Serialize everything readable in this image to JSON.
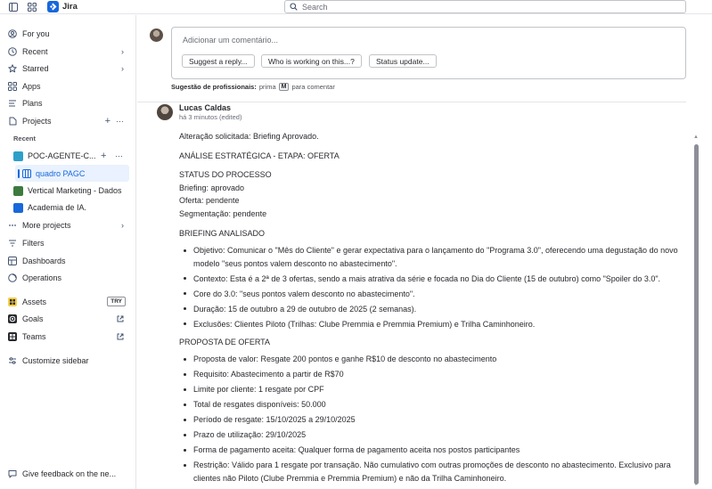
{
  "app": {
    "name": "Jira"
  },
  "search": {
    "placeholder": "Search"
  },
  "sidebar": {
    "items_top": [
      {
        "label": "For you",
        "icon": "user-circle-icon"
      },
      {
        "label": "Recent",
        "icon": "clock-icon"
      },
      {
        "label": "Starred",
        "icon": "star-icon"
      },
      {
        "label": "Apps",
        "icon": "apps-icon"
      },
      {
        "label": "Plans",
        "icon": "plans-icon"
      },
      {
        "label": "Projects",
        "icon": "projects-icon"
      }
    ],
    "recent_label": "Recent",
    "projects": [
      {
        "label": "POC-AGENTE-C...",
        "color": "#2e9fc9"
      },
      {
        "label": "quadro PAGC"
      },
      {
        "label": "Vertical Marketing - Dados",
        "color": "#3d7a3f"
      },
      {
        "label": "Academia de IA.",
        "color": "#1868db"
      }
    ],
    "more_projects": "More projects",
    "items_bottom": [
      {
        "label": "Filters",
        "icon": "filter-icon"
      },
      {
        "label": "Dashboards",
        "icon": "dashboard-icon"
      },
      {
        "label": "Operations",
        "icon": "operations-icon"
      }
    ],
    "apps": [
      {
        "label": "Assets",
        "badge": "TRY",
        "color": "#f5cd47"
      },
      {
        "label": "Goals",
        "color": "#292a2e"
      },
      {
        "label": "Teams",
        "color": "#292a2e"
      }
    ],
    "customize": "Customize sidebar",
    "feedback": "Give feedback on the ne..."
  },
  "comment_editor": {
    "placeholder": "Adicionar um comentário...",
    "suggestions": [
      "Suggest a reply...",
      "Who is working on this...?",
      "Status update..."
    ],
    "tip_bold": "Sugestão de profissionais:",
    "tip_pre": "prima",
    "tip_key": "M",
    "tip_post": "para comentar"
  },
  "comment": {
    "author": "Lucas Caldas",
    "meta": "há 3 minutos (edited)",
    "line1": "Alteração solicitada: Briefing Aprovado.",
    "line2": "ANÁLISE ESTRATÉGICA - ETAPA: OFERTA",
    "status_title": "STATUS DO PROCESSO",
    "status_lines": [
      "Briefing: aprovado",
      "Oferta: pendente",
      "Segmentação: pendente"
    ],
    "briefing_title": "BRIEFING ANALISADO",
    "briefing_items": [
      "Objetivo: Comunicar o \"Mês do Cliente\" e gerar expectativa para o lançamento do \"Programa 3.0\", oferecendo uma degustação do novo modelo \"seus pontos valem desconto no abastecimento\".",
      "Contexto: Esta é a 2ª de 3 ofertas, sendo a mais atrativa da série e focada no Dia do Cliente (15 de outubro) como \"Spoiler do 3.0\".",
      "Core do 3.0: \"seus pontos valem desconto no abastecimento\".",
      "Duração: 15 de outubro a 29 de outubro de 2025 (2 semanas).",
      "Exclusões: Clientes Piloto (Trilhas: Clube Premmia e Premmia Premium) e Trilha Caminhoneiro."
    ],
    "offer_title": "PROPOSTA DE OFERTA",
    "offer_items": [
      "Proposta de valor: Resgate 200 pontos e ganhe R$10 de desconto no abastecimento",
      "Requisito: Abastecimento a partir de R$70",
      "Limite por cliente: 1 resgate por CPF",
      "Total de resgates disponíveis: 50.000",
      "Período de resgate: 15/10/2025 a 29/10/2025",
      "Prazo de utilização: 29/10/2025",
      "Forma de pagamento aceita: Qualquer forma de pagamento aceita nos postos participantes",
      "Restrição: Válido para 1 resgate por transação. Não cumulativo com outras promoções de desconto no abastecimento. Exclusivo para clientes não Piloto (Clube Premmia e Premmia Premium) e não da Trilha Caminhoneiro."
    ]
  },
  "colors": {
    "accent": "#1868db",
    "selected_bg": "#e9f2fe"
  }
}
